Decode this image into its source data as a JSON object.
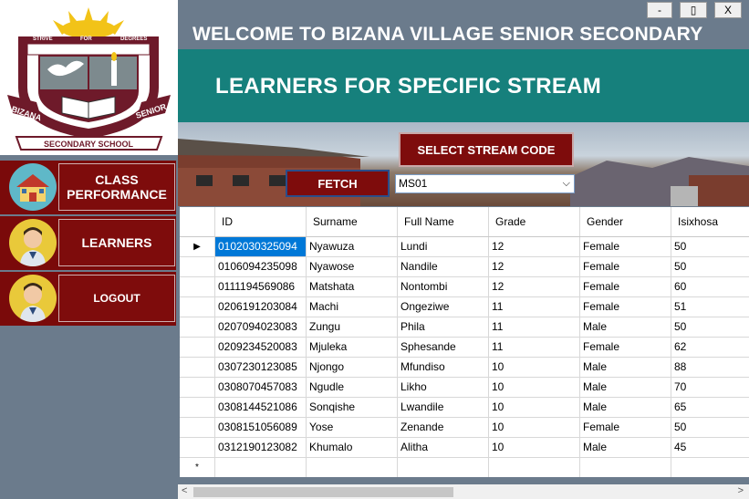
{
  "window": {
    "min_label": "-",
    "max_label": "▯",
    "close_label": "X"
  },
  "header": {
    "welcome": "WELCOME TO BIZANA VILLAGE SENIOR SECONDARY"
  },
  "banner": {
    "title": "LEARNERS FOR SPECIFIC STREAM"
  },
  "logo": {
    "motto_left": "STRIVE",
    "motto_mid": "FOR",
    "motto_right": "DEGREES",
    "name_left": "BIZANA",
    "name_right": "SENIOR",
    "ribbon": "SECONDARY SCHOOL"
  },
  "nav": [
    {
      "label": "CLASS PERFORMANCE",
      "icon": "school-building-icon"
    },
    {
      "label": "LEARNERS",
      "icon": "learner-avatar-icon"
    },
    {
      "label": "LOGOUT",
      "icon": "learner-avatar-icon"
    }
  ],
  "controls": {
    "select_stream_label": "SELECT STREAM CODE",
    "fetch_label": "FETCH",
    "stream_value": "MS01"
  },
  "grid": {
    "columns": [
      "ID",
      "Surname",
      "Full Name",
      "Grade",
      "Gender",
      "Isixhosa"
    ],
    "rows": [
      [
        "0102030325094",
        "Nyawuza",
        "Lundi",
        "12",
        "Female",
        "50"
      ],
      [
        "0106094235098",
        "Nyawose",
        "Nandile",
        "12",
        "Female",
        "50"
      ],
      [
        "0111194569086",
        "Matshata",
        "Nontombi",
        "12",
        "Female",
        "60"
      ],
      [
        "0206191203084",
        "Machi",
        "Ongeziwe",
        "11",
        "Female",
        "51"
      ],
      [
        "0207094023083",
        "Zungu",
        "Phila",
        "11",
        "Male",
        "50"
      ],
      [
        "0209234520083",
        "Mjuleka",
        "Sphesande",
        "11",
        "Female",
        "62"
      ],
      [
        "0307230123085",
        "Njongo",
        "Mfundiso",
        "10",
        "Male",
        "88"
      ],
      [
        "0308070457083",
        "Ngudle",
        "Likho",
        "10",
        "Male",
        "70"
      ],
      [
        "0308144521086",
        "Sonqishe",
        "Lwandile",
        "10",
        "Male",
        "65"
      ],
      [
        "0308151056089",
        "Yose",
        "Zenande",
        "10",
        "Female",
        "50"
      ],
      [
        "0312190123082",
        "Khumalo",
        "Alitha",
        "10",
        "Male",
        "45"
      ]
    ],
    "current_row_marker": "▶",
    "new_row_marker": "*"
  },
  "scrollbar": {
    "left_arrow": "<",
    "right_arrow": ">"
  },
  "colors": {
    "maroon": "#7e0c0c",
    "teal": "#16807c",
    "slate": "#6b7b8c",
    "select_blue": "#0078d7"
  }
}
